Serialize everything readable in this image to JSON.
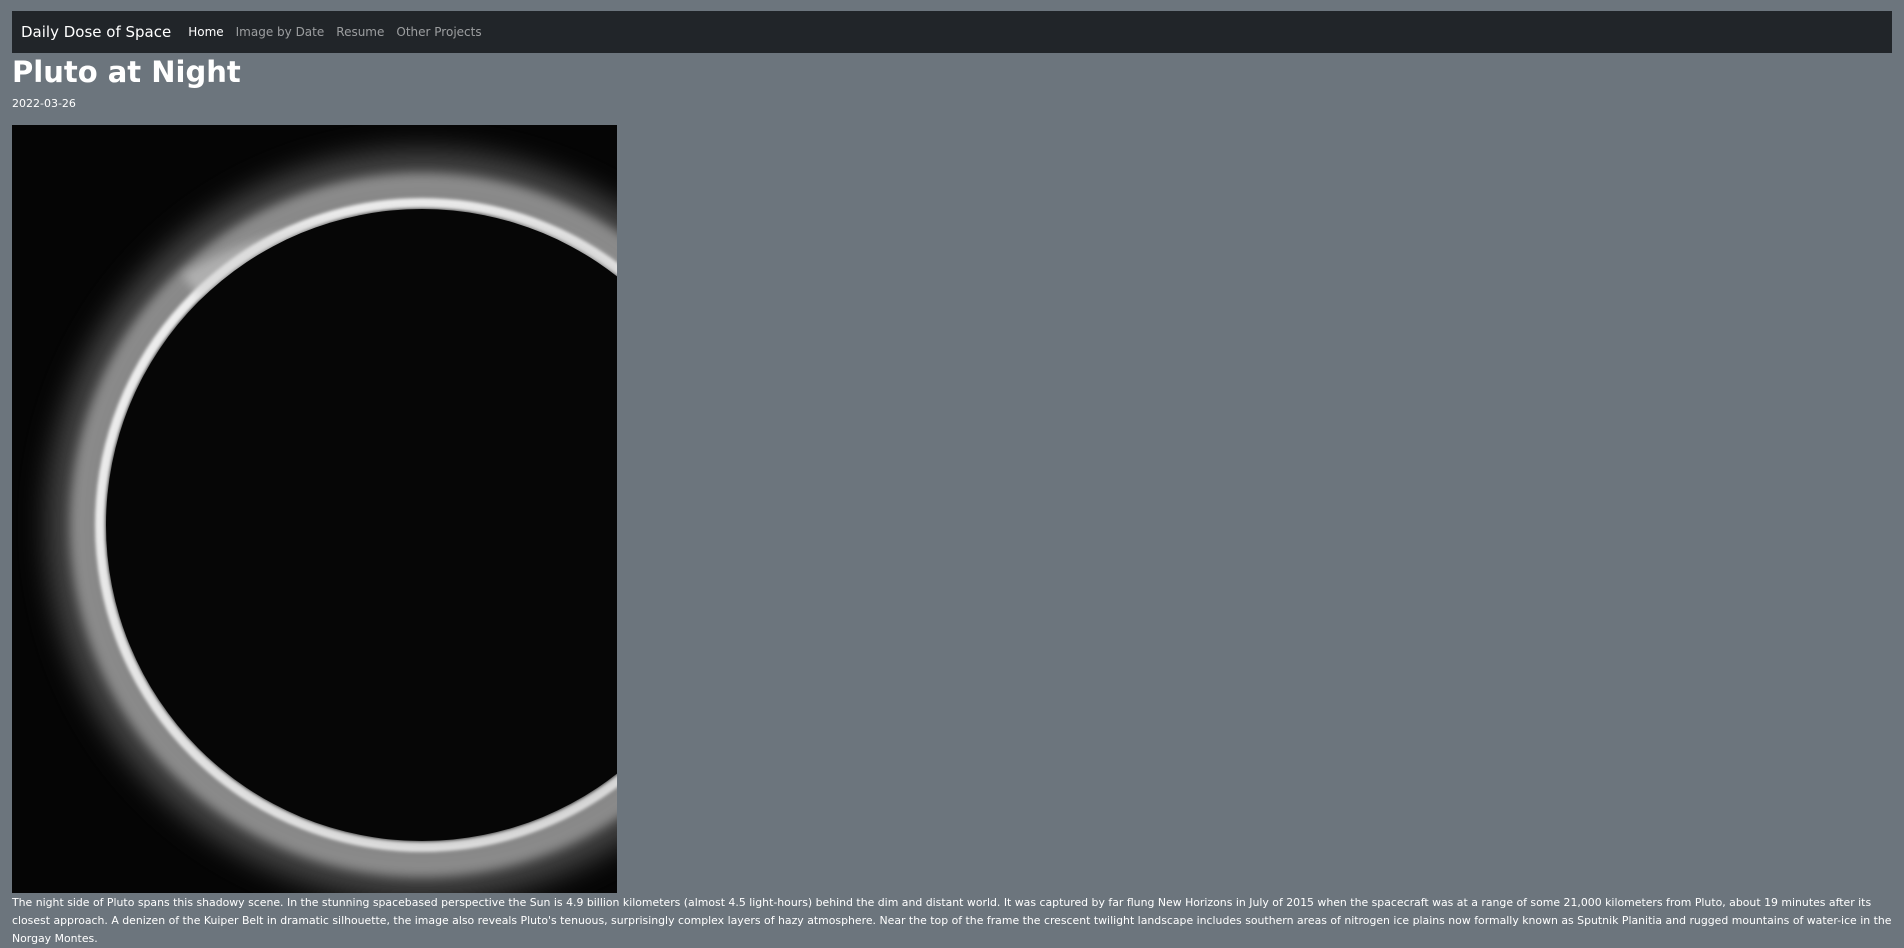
{
  "nav": {
    "brand": "Daily Dose of Space",
    "links": [
      {
        "label": "Home",
        "active": true
      },
      {
        "label": "Image by Date",
        "active": false
      },
      {
        "label": "Resume",
        "active": false
      },
      {
        "label": "Other Projects",
        "active": false
      }
    ]
  },
  "article": {
    "title": "Pluto at Night",
    "date": "2022-03-26",
    "description": "The night side of Pluto spans this shadowy scene. In the stunning spacebased perspective the Sun is 4.9 billion kilometers (almost 4.5 light-hours) behind the dim and distant world. It was captured by far flung New Horizons in July of 2015 when the spacecraft was at a range of some 21,000 kilometers from Pluto, about 19 minutes after its closest approach. A denizen of the Kuiper Belt in dramatic silhouette, the image also reveals Pluto's tenuous, surprisingly complex layers of hazy atmosphere. Near the top of the frame the crescent twilight landscape includes southern areas of nitrogen ice plains now formally known as Sputnik Planitia and rugged mountains of water-ice in the Norgay Montes."
  },
  "colors": {
    "page_background": "#6c757d",
    "navbar_background": "#212529",
    "text": "#ffffff"
  }
}
